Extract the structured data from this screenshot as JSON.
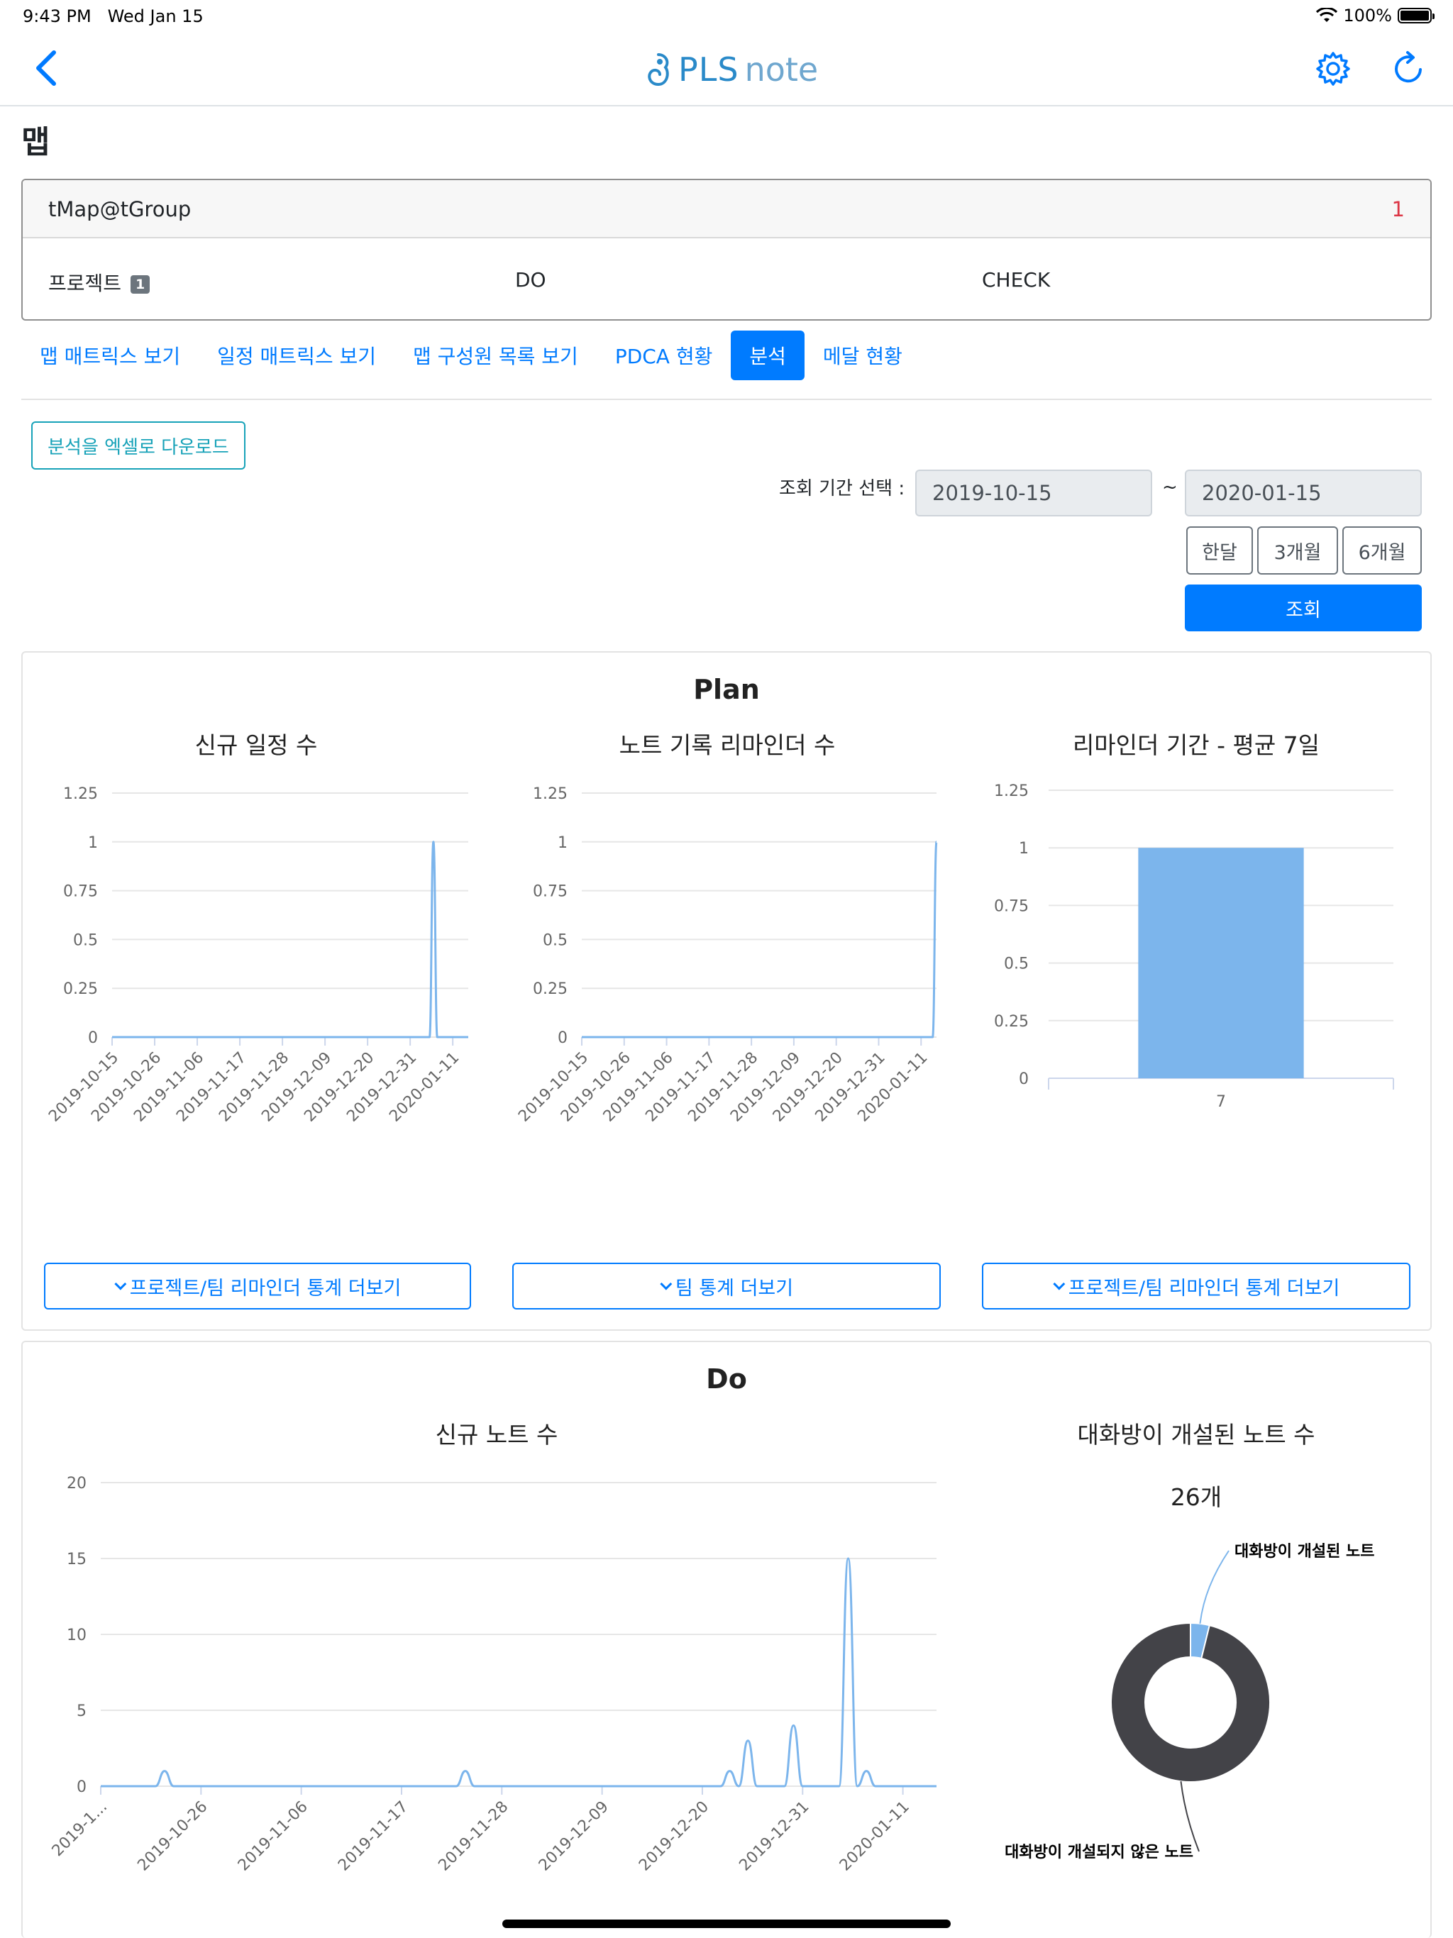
{
  "status_bar": {
    "time": "9:43 PM",
    "date": "Wed Jan 15",
    "battery": "100%"
  },
  "nav": {
    "logo_main": "PLS",
    "logo_sub": "note"
  },
  "page_title": "맵",
  "group": {
    "name": "tMap@tGroup",
    "count": "1",
    "columns": {
      "project": "프로젝트",
      "project_badge": "1",
      "do": "DO",
      "check": "CHECK"
    }
  },
  "tabs": [
    "맵 매트릭스 보기",
    "일정 매트릭스 보기",
    "맵 구성원 목록 보기",
    "PDCA 현황",
    "분석",
    "메달 현황"
  ],
  "active_tab": "분석",
  "excel_button": "분석을 엑셀로 다운로드",
  "period": {
    "label": "조회 기간 선택 :",
    "start": "2019-10-15",
    "tilde": "~",
    "end": "2020-01-15",
    "ranges": [
      "한달",
      "3개월",
      "6개월"
    ],
    "search": "조회"
  },
  "plan": {
    "title": "Plan",
    "more_buttons": [
      "프로젝트/팀 리마인더 통계 더보기",
      "팀 통계 더보기",
      "프로젝트/팀 리마인더 통계 더보기"
    ]
  },
  "do": {
    "title": "Do",
    "donut_total": "26개"
  },
  "colors": {
    "primary": "#007bff",
    "series": "#7cb5ec",
    "dark": "#434348",
    "teal": "#17a2b8",
    "danger": "#dc3545"
  },
  "chart_data": [
    {
      "type": "line",
      "title": "신규 일정 수",
      "x_ticks": [
        "2019-10-15",
        "2019-10-26",
        "2019-11-06",
        "2019-11-17",
        "2019-11-28",
        "2019-12-09",
        "2019-12-20",
        "2019-12-31",
        "2020-01-11"
      ],
      "x_range": [
        "2019-10-15",
        "2020-01-15"
      ],
      "ylim": [
        0,
        1.25
      ],
      "y_ticks": [
        "0",
        "0.25",
        "0.5",
        "0.75",
        "1",
        "1.25"
      ],
      "series": [
        {
          "points": [
            [
              "2019-10-15",
              0
            ],
            [
              "2020-01-05",
              0
            ],
            [
              "2020-01-06",
              1
            ],
            [
              "2020-01-07",
              0
            ],
            [
              "2020-01-15",
              0
            ]
          ]
        }
      ]
    },
    {
      "type": "line",
      "title": "노트 기록 리마인더 수",
      "x_ticks": [
        "2019-10-15",
        "2019-10-26",
        "2019-11-06",
        "2019-11-17",
        "2019-11-28",
        "2019-12-09",
        "2019-12-20",
        "2019-12-31",
        "2020-01-11"
      ],
      "x_range": [
        "2019-10-15",
        "2020-01-15"
      ],
      "ylim": [
        0,
        1.25
      ],
      "y_ticks": [
        "0",
        "0.25",
        "0.5",
        "0.75",
        "1",
        "1.25"
      ],
      "series": [
        {
          "points": [
            [
              "2019-10-15",
              0
            ],
            [
              "2020-01-14",
              0
            ],
            [
              "2020-01-15",
              1
            ]
          ]
        }
      ]
    },
    {
      "type": "bar",
      "title": "리마인더 기간 - 평균 7일",
      "categories": [
        "7"
      ],
      "values": [
        1
      ],
      "ylim": [
        0,
        1.25
      ],
      "y_ticks": [
        "0",
        "0.25",
        "0.5",
        "0.75",
        "1",
        "1.25"
      ]
    },
    {
      "type": "line",
      "title": "신규 노트 수",
      "x_ticks": [
        "2019-1...",
        "2019-10-26",
        "2019-11-06",
        "2019-11-17",
        "2019-11-28",
        "2019-12-09",
        "2019-12-20",
        "2019-12-31",
        "2020-01-11"
      ],
      "x_range": [
        "2019-10-15",
        "2020-01-15"
      ],
      "ylim": [
        0,
        20
      ],
      "y_ticks": [
        "0",
        "5",
        "10",
        "15",
        "20"
      ],
      "series": [
        {
          "points": [
            [
              "2019-10-15",
              0
            ],
            [
              "2019-10-21",
              0
            ],
            [
              "2019-10-22",
              1
            ],
            [
              "2019-10-23",
              0
            ],
            [
              "2019-11-23",
              0
            ],
            [
              "2019-11-24",
              1
            ],
            [
              "2019-11-25",
              0
            ],
            [
              "2019-12-22",
              0
            ],
            [
              "2019-12-23",
              1
            ],
            [
              "2019-12-24",
              0
            ],
            [
              "2019-12-25",
              3
            ],
            [
              "2019-12-26",
              0
            ],
            [
              "2019-12-29",
              0
            ],
            [
              "2019-12-30",
              4
            ],
            [
              "2019-12-31",
              0
            ],
            [
              "2020-01-04",
              0
            ],
            [
              "2020-01-05",
              15
            ],
            [
              "2020-01-06",
              0
            ],
            [
              "2020-01-07",
              1
            ],
            [
              "2020-01-08",
              0
            ],
            [
              "2020-01-15",
              0
            ]
          ]
        }
      ]
    },
    {
      "type": "pie",
      "title": "대화방이 개설된 노트 수",
      "slices": [
        {
          "label": "대화방이 개설된 노트",
          "value": 1,
          "color": "#7cb5ec"
        },
        {
          "label": "대화방이 개설되지 않은 노트",
          "value": 25,
          "color": "#434348"
        }
      ]
    }
  ]
}
